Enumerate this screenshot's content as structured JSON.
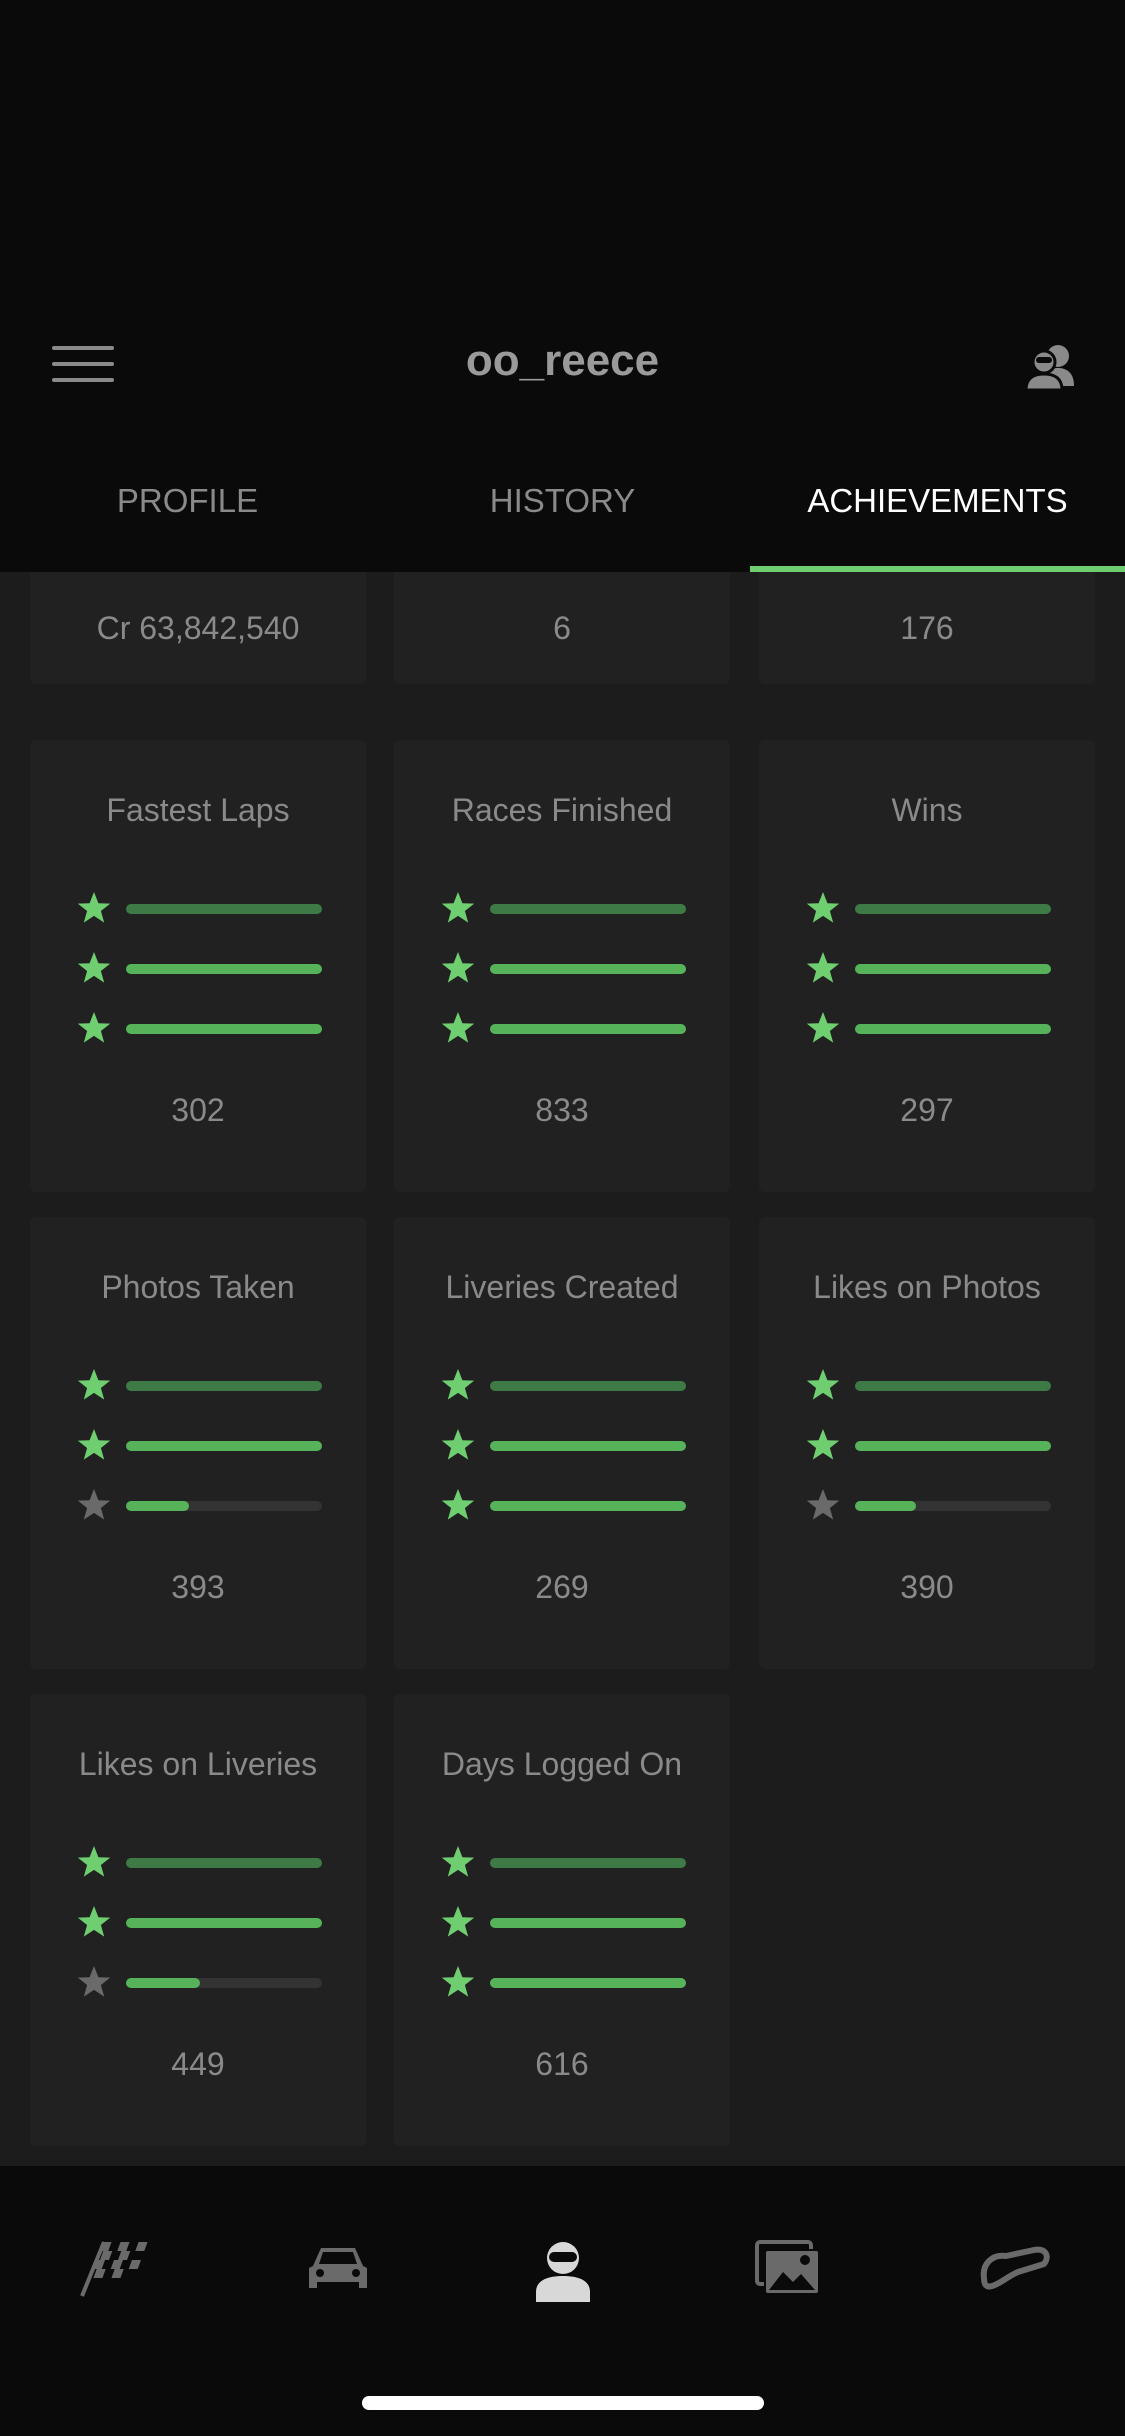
{
  "header": {
    "username": "oo_reece",
    "menu_icon": "hamburger-menu-icon",
    "friends_icon": "friends-icon"
  },
  "tabs": [
    {
      "label": "PROFILE",
      "active": false
    },
    {
      "label": "HISTORY",
      "active": false
    },
    {
      "label": "ACHIEVEMENTS",
      "active": true
    }
  ],
  "colors": {
    "accent": "#6fcf70",
    "star_active": "#6fcf70",
    "star_inactive": "#6a6a6a",
    "bar_fill": "#56b35a",
    "bar_fill_dark": "#3e7a45"
  },
  "top_stats": [
    {
      "value": "Cr 63,842,540"
    },
    {
      "value": "6"
    },
    {
      "value": "176"
    }
  ],
  "achievements": [
    {
      "title": "Fastest Laps",
      "value": "302",
      "tiers": [
        1,
        1,
        1
      ]
    },
    {
      "title": "Races Finished",
      "value": "833",
      "tiers": [
        1,
        1,
        1
      ]
    },
    {
      "title": "Wins",
      "value": "297",
      "tiers": [
        1,
        1,
        1
      ]
    },
    {
      "title": "Photos Taken",
      "value": "393",
      "tiers": [
        1,
        1,
        0.32
      ]
    },
    {
      "title": "Liveries Created",
      "value": "269",
      "tiers": [
        1,
        1,
        1
      ]
    },
    {
      "title": "Likes on Photos",
      "value": "390",
      "tiers": [
        1,
        1,
        0.31
      ]
    },
    {
      "title": "Likes on Liveries",
      "value": "449",
      "tiers": [
        1,
        1,
        0.38
      ]
    },
    {
      "title": "Days Logged On",
      "value": "616",
      "tiers": [
        1,
        1,
        1
      ]
    }
  ],
  "bottom_nav": [
    {
      "icon": "race-flag-icon",
      "active": false
    },
    {
      "icon": "car-icon",
      "active": false
    },
    {
      "icon": "driver-profile-icon",
      "active": true
    },
    {
      "icon": "photos-icon",
      "active": false
    },
    {
      "icon": "track-icon",
      "active": false
    }
  ]
}
